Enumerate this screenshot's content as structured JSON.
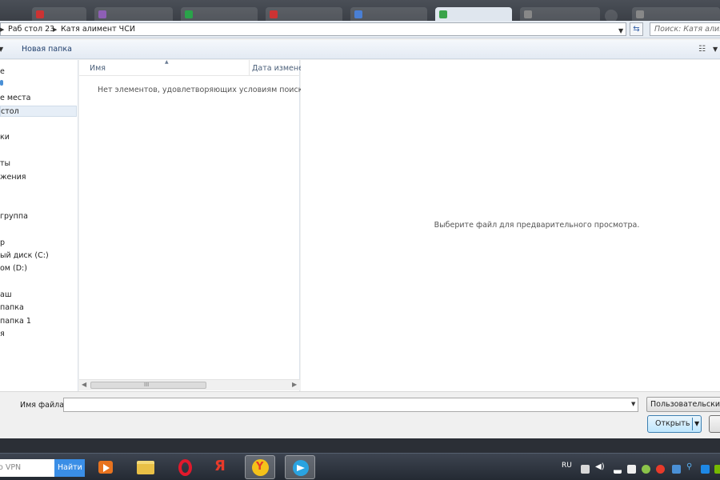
{
  "address_bar": {
    "crumbs": [
      "Раб стол 23",
      "Катя алимент ЧСИ"
    ],
    "search_placeholder": "Поиск: Катя алимент"
  },
  "toolbar": {
    "new_folder_label": "Новая папка"
  },
  "nav_pane": {
    "items": [
      {
        "label": "е"
      },
      {
        "label": "е места"
      },
      {
        "label": "стол",
        "selected": true
      },
      {
        "label": "ки"
      },
      {
        "label": "ты"
      },
      {
        "label": "жения"
      },
      {
        "label": "группа"
      },
      {
        "label": "р"
      },
      {
        "label": "ый диск (C:)"
      },
      {
        "label": "ом (D:)"
      },
      {
        "label": "аш"
      },
      {
        "label": "папка"
      },
      {
        "label": "папка 1"
      },
      {
        "label": "я"
      }
    ]
  },
  "file_list": {
    "col_name": "Имя",
    "col_date": "Дата изменен",
    "empty_message": "Нет элементов, удовлетворяющих условиям поиска.",
    "scroll_grip": "III"
  },
  "preview": {
    "message": "Выберите файл для предварительного просмотра."
  },
  "bottom": {
    "filename_label": "Имя файла:",
    "filename_value": "",
    "filter_label": "Пользовательские ф",
    "open_label": "Открыть"
  },
  "taskbar": {
    "vpn_text": "о VPN",
    "find_label": "Найти",
    "language": "RU",
    "apps": [
      {
        "name": "media-player-icon",
        "color": "#e8731f"
      },
      {
        "name": "file-explorer-icon",
        "color": "#e9c046"
      },
      {
        "name": "opera-icon",
        "color": "#e2192c"
      },
      {
        "name": "yandex-icon",
        "color": "#e83a2a"
      },
      {
        "name": "yandex-browser-icon",
        "color": "#f5c21a"
      },
      {
        "name": "telegram-icon",
        "color": "#2aa3e0"
      }
    ]
  },
  "colors": {
    "accent": "#3c7fb1",
    "selection": "#e6eef7"
  }
}
